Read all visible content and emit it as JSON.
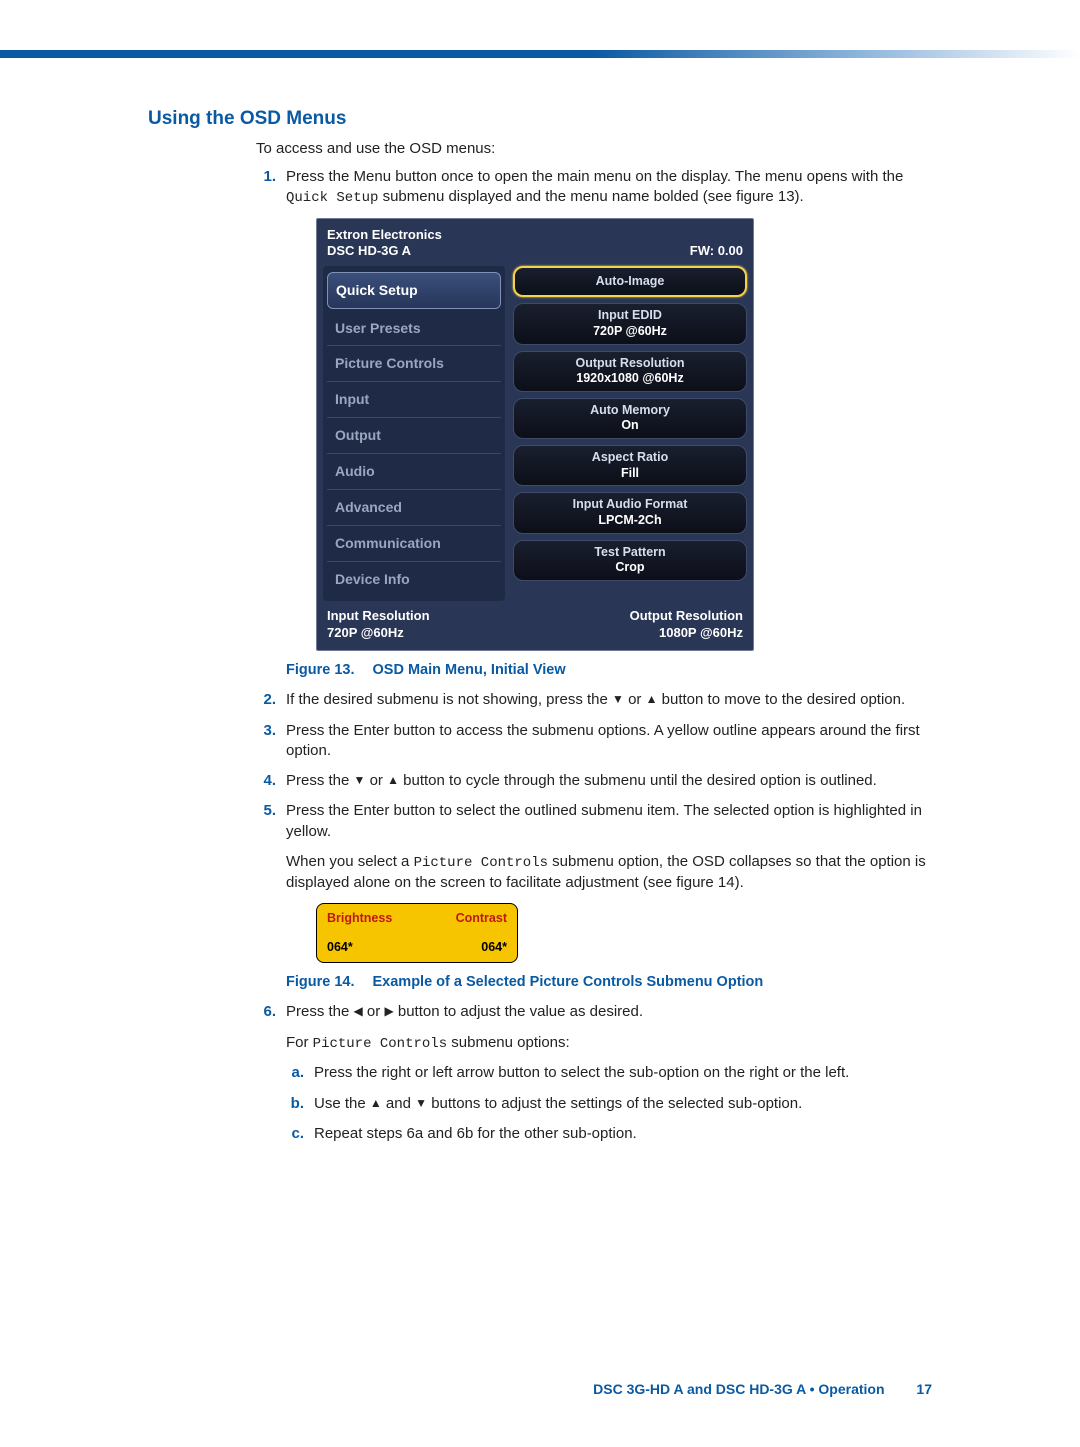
{
  "heading": "Using the OSD Menus",
  "intro": "To access and use the OSD menus:",
  "steps": {
    "s1a": "Press the Menu button once to open the main menu on the display. The menu opens with the ",
    "s1mono": "Quick Setup",
    "s1b": " submenu displayed and the menu name bolded (see figure 13).",
    "s2a": "If the desired submenu is not showing, press the ",
    "s2b": " or ",
    "s2c": " button to move to the desired option.",
    "s3": "Press the Enter button to access the submenu options. A yellow outline appears around the first option.",
    "s4a": "Press the ",
    "s4b": " or ",
    "s4c": " button to cycle through the submenu until the desired option is outlined.",
    "s5": "Press the Enter button to select the outlined submenu item. The selected option is highlighted in yellow.",
    "s5pa": "When you select a ",
    "s5mono": "Picture Controls",
    "s5pb": " submenu option, the OSD collapses so that the option is displayed alone on the screen to facilitate adjustment (see figure 14).",
    "s6a": "Press the ",
    "s6b": " or ",
    "s6c": " button to adjust the value as desired.",
    "s6pa": "For ",
    "s6mono": "Picture Controls",
    "s6pb": " submenu options:",
    "a": "Press the right or left arrow button to select the sub-option on the right or the left.",
    "bA": "Use the ",
    "bB": " and ",
    "bC": " buttons to adjust the settings of the selected sub-option.",
    "c": "Repeat steps 6a and 6b for the other sub-option."
  },
  "glyphs": {
    "up": "▲",
    "down": "▼",
    "left": "◀",
    "right": "▶"
  },
  "fig13": {
    "num": "Figure 13.",
    "title": "OSD Main Menu, Initial View"
  },
  "fig14": {
    "num": "Figure 14.",
    "title": "Example of a Selected Picture Controls Submenu Option"
  },
  "osd": {
    "brand1": "Extron Electronics",
    "brand2": "DSC HD-3G A",
    "fw": "FW: 0.00",
    "menu": [
      "Quick Setup",
      "User Presets",
      "Picture Controls",
      "Input",
      "Output",
      "Audio",
      "Advanced",
      "Communication",
      "Device Info"
    ],
    "pills": [
      {
        "t": "Auto-Image",
        "v": ""
      },
      {
        "t": "Input EDID",
        "v": "720P @60Hz"
      },
      {
        "t": "Output Resolution",
        "v": "1920x1080 @60Hz"
      },
      {
        "t": "Auto Memory",
        "v": "On"
      },
      {
        "t": "Aspect Ratio",
        "v": "Fill"
      },
      {
        "t": "Input Audio Format",
        "v": "LPCM-2Ch"
      },
      {
        "t": "Test Pattern",
        "v": "Crop"
      }
    ],
    "footL1": "Input Resolution",
    "footL2": "720P @60Hz",
    "footR1": "Output Resolution",
    "footR2": "1080P @60Hz"
  },
  "pc": {
    "l1": "Brightness",
    "r1": "Contrast",
    "l2": "064*",
    "r2": "064*"
  },
  "footer": {
    "text": "DSC 3G-HD A and DSC HD-3G A • Operation",
    "page": "17"
  }
}
